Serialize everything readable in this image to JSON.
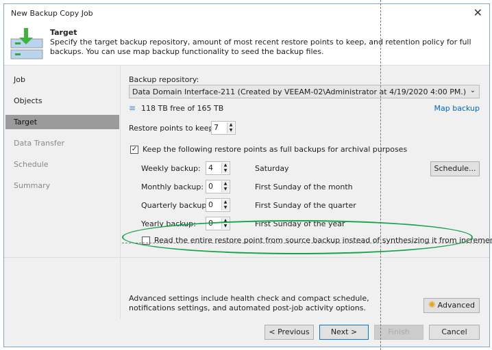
{
  "window": {
    "title": "New Backup Copy Job",
    "close_icon": "close-icon"
  },
  "header": {
    "title": "Target",
    "description": "Specify the target backup repository, amount of most recent restore points to keep, and retention policy for full backups. You can use map backup functionality to seed the backup files."
  },
  "sidebar": {
    "items": [
      {
        "label": "Job",
        "state": "normal"
      },
      {
        "label": "Objects",
        "state": "normal"
      },
      {
        "label": "Target",
        "state": "active"
      },
      {
        "label": "Data Transfer",
        "state": "disabled"
      },
      {
        "label": "Schedule",
        "state": "disabled"
      },
      {
        "label": "Summary",
        "state": "disabled"
      }
    ]
  },
  "main": {
    "repo_label": "Backup repository:",
    "repo_value": "Data Domain Interface-211 (Created by VEEAM-02\\Administrator at 4/19/2020 4:00 PM.)",
    "free_space": "118 TB free of 165 TB",
    "map_backup": "Map backup",
    "restore_points_label": "Restore points to keep:",
    "restore_points_value": "7",
    "gfs_label": "Keep the following restore points as full backups for archival purposes",
    "gfs_checked": true,
    "gfs": [
      {
        "label": "Weekly backup:",
        "value": "4",
        "desc": "Saturday"
      },
      {
        "label": "Monthly backup:",
        "value": "0",
        "desc": "First Sunday of the month"
      },
      {
        "label": "Quarterly backup:",
        "value": "0",
        "desc": "First Sunday of the quarter"
      },
      {
        "label": "Yearly backup:",
        "value": "0",
        "desc": "First Sunday of the year"
      }
    ],
    "schedule_button": "Schedule...",
    "read_entire_label": "Read the entire restore point from source backup instead of synthesizing it from increments",
    "read_entire_checked": false,
    "advanced_text": "Advanced settings include health check and compact schedule, notifications settings, and automated post-job activity options.",
    "advanced_button": "Advanced"
  },
  "footer": {
    "previous": "< Previous",
    "next": "Next >",
    "finish": "Finish",
    "cancel": "Cancel"
  },
  "colors": {
    "highlight_ellipse": "#16a34a",
    "accent": "#0078d7",
    "sidebar_active": "#9b9b9b"
  }
}
